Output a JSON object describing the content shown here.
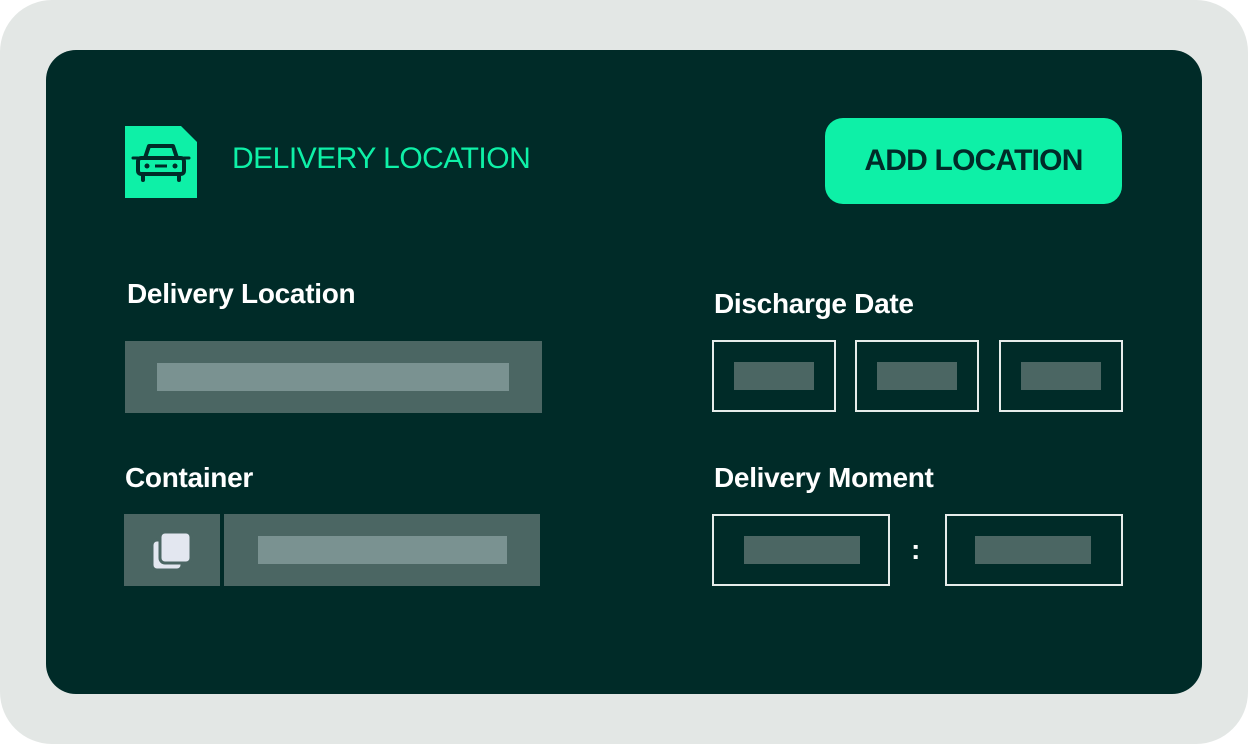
{
  "header": {
    "title": "DELIVERY LOCATION",
    "icon": "car-icon",
    "add_button_label": "ADD LOCATION"
  },
  "form": {
    "delivery_location": {
      "label": "Delivery Location",
      "value": ""
    },
    "container": {
      "label": "Container",
      "icon": "copy-icon",
      "value": ""
    },
    "discharge_date": {
      "label": "Discharge Date",
      "parts": [
        "",
        "",
        ""
      ]
    },
    "delivery_moment": {
      "label": "Delivery Moment",
      "separator": ":",
      "parts": [
        "",
        ""
      ]
    }
  },
  "colors": {
    "accent": "#0ef0a7",
    "card_background": "#002b28",
    "frame_background": "#e3e7e5",
    "field_fill": "#4b6663",
    "placeholder_bar": "#7a9291",
    "outline": "#e6ecea"
  }
}
